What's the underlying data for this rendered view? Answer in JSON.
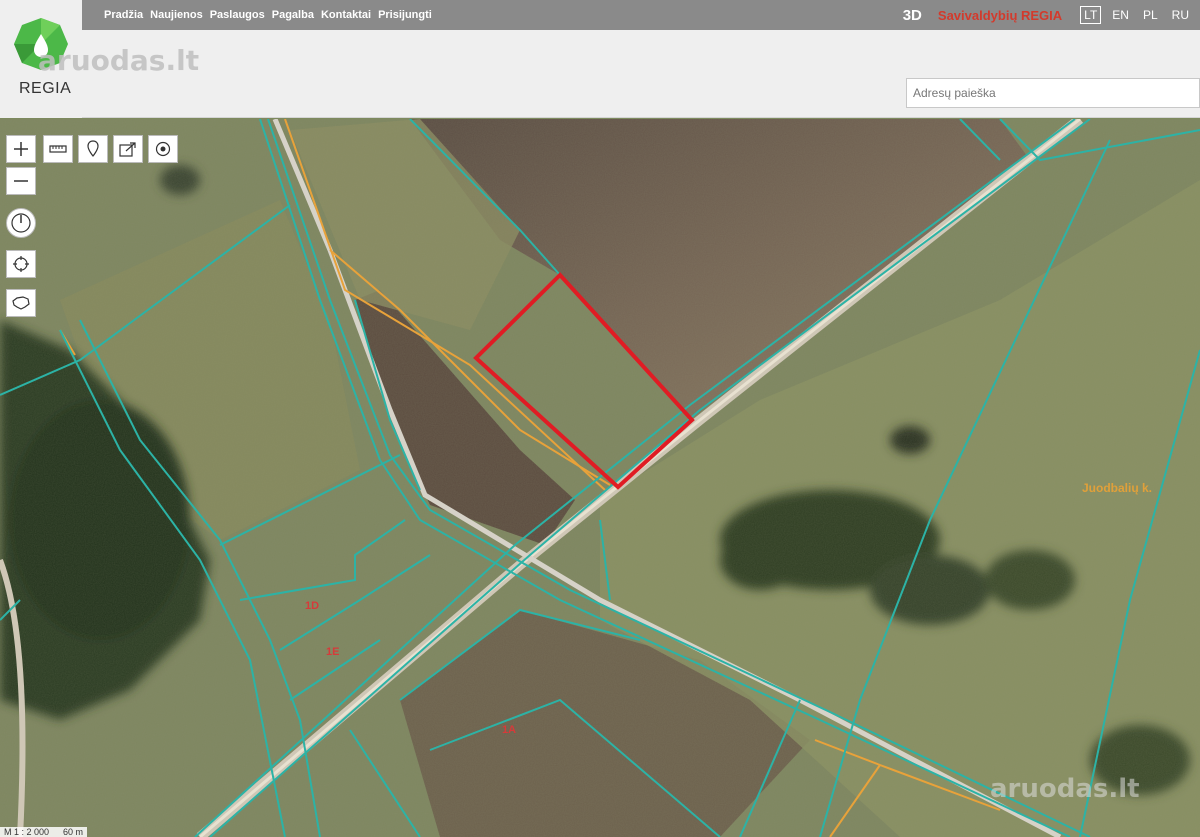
{
  "nav": {
    "items": [
      "Pradžia",
      "Naujienos",
      "Paslaugos",
      "Pagalba",
      "Kontaktai",
      "Prisijungti"
    ],
    "view_3d": "3D",
    "brand": "Savivaldybių REGIA",
    "languages": [
      "LT",
      "EN",
      "PL",
      "RU"
    ],
    "active_language": "LT"
  },
  "header": {
    "logo_text": "REGIA",
    "watermark": "aruodas.lt",
    "search_placeholder": "Adresų paieška"
  },
  "map": {
    "parcel_labels": [
      "1D",
      "1E",
      "1A"
    ],
    "place_label": "Juodbalių k.",
    "watermark": "aruodas.lt",
    "scale_text": "M 1 : 2 000",
    "scale_bar_text": "60 m",
    "colors": {
      "parcel_boundary": "#2cb3a6",
      "highlight": "#e01c24",
      "orange_line": "#e8a23a",
      "road": "#cfc7b6"
    }
  },
  "tools": [
    {
      "name": "zoom-in",
      "icon": "plus-icon"
    },
    {
      "name": "zoom-out",
      "icon": "minus-icon"
    },
    {
      "name": "measure",
      "icon": "ruler-icon"
    },
    {
      "name": "marker",
      "icon": "map-pin-icon"
    },
    {
      "name": "share",
      "icon": "share-icon"
    },
    {
      "name": "layer",
      "icon": "target-icon"
    },
    {
      "name": "compass",
      "icon": "compass-icon"
    },
    {
      "name": "locate",
      "icon": "crosshair-icon"
    },
    {
      "name": "lithuania",
      "icon": "country-outline-icon"
    }
  ]
}
